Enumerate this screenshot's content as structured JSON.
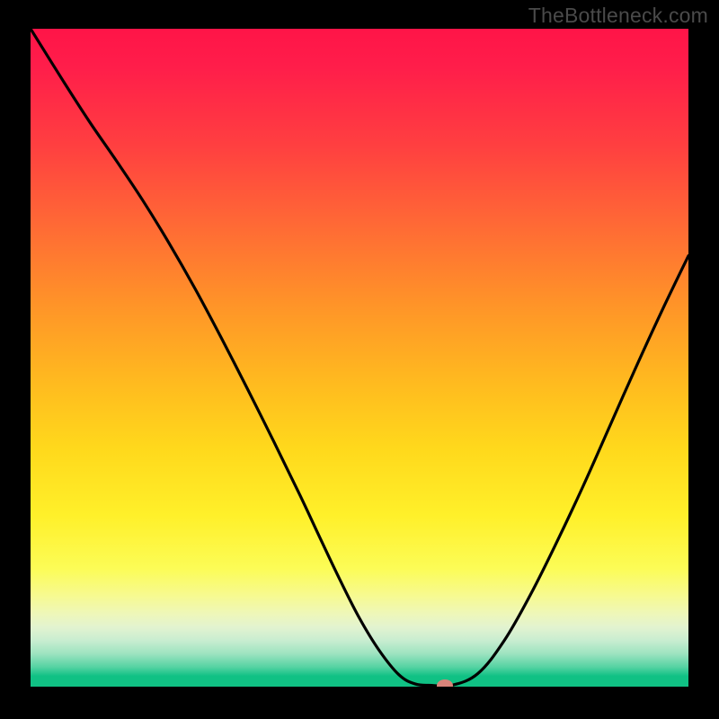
{
  "watermark": "TheBottleneck.com",
  "chart_data": {
    "type": "line",
    "title": "",
    "xlabel": "",
    "ylabel": "",
    "x": [
      0.0,
      0.05,
      0.09,
      0.13,
      0.17,
      0.21,
      0.25,
      0.29,
      0.33,
      0.37,
      0.41,
      0.44,
      0.47,
      0.5,
      0.53,
      0.56,
      0.585,
      0.61,
      0.64,
      0.68,
      0.72,
      0.76,
      0.8,
      0.84,
      0.88,
      0.92,
      0.96,
      1.0
    ],
    "y": [
      1.0,
      0.92,
      0.858,
      0.8,
      0.74,
      0.675,
      0.605,
      0.53,
      0.452,
      0.372,
      0.29,
      0.226,
      0.163,
      0.104,
      0.055,
      0.018,
      0.004,
      0.002,
      0.002,
      0.02,
      0.07,
      0.14,
      0.22,
      0.305,
      0.395,
      0.485,
      0.572,
      0.655
    ],
    "xlim": [
      0,
      1
    ],
    "ylim": [
      0,
      1
    ],
    "marker": {
      "x": 0.63,
      "y": 0.002
    },
    "background": "vertical-gradient(red->orange->yellow->green)",
    "line_color": "#000000"
  }
}
